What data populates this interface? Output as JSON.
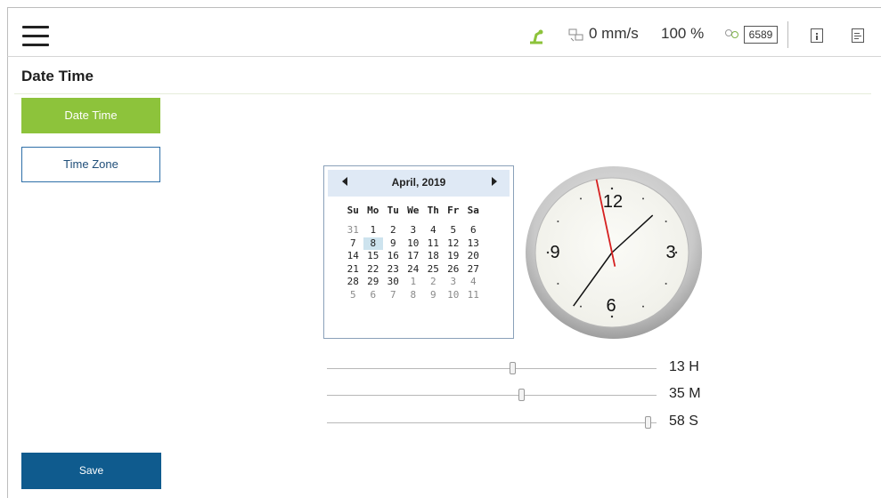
{
  "topbar": {
    "speed": "0 mm/s",
    "speed_percent": "100 %",
    "counter": "6589",
    "robot_icon_color": "#8dc33b"
  },
  "page": {
    "title": "Date Time"
  },
  "nav": {
    "items": [
      {
        "label": "Date Time",
        "active": true
      },
      {
        "label": "Time Zone",
        "active": false
      }
    ]
  },
  "calendar": {
    "month_label": "April, 2019",
    "days_of_week": [
      "Su",
      "Mo",
      "Tu",
      "We",
      "Th",
      "Fr",
      "Sa"
    ],
    "selected_day": "8",
    "weeks": [
      [
        "31",
        "1",
        "2",
        "3",
        "4",
        "5",
        "6"
      ],
      [
        "7",
        "8",
        "9",
        "10",
        "11",
        "12",
        "13"
      ],
      [
        "14",
        "15",
        "16",
        "17",
        "18",
        "19",
        "20"
      ],
      [
        "21",
        "22",
        "23",
        "24",
        "25",
        "26",
        "27"
      ],
      [
        "28",
        "29",
        "30",
        "1",
        "2",
        "3",
        "4"
      ],
      [
        "5",
        "6",
        "7",
        "8",
        "9",
        "10",
        "11"
      ]
    ]
  },
  "clock": {
    "numerals": [
      "12",
      "3",
      "6",
      "9"
    ],
    "hours": 13,
    "minutes": 35,
    "seconds": 58
  },
  "sliders": [
    {
      "label": "13 H",
      "value": 13,
      "max": 23
    },
    {
      "label": "35 M",
      "value": 35,
      "max": 59
    },
    {
      "label": "58 S",
      "value": 58,
      "max": 59
    }
  ],
  "actions": {
    "save_label": "Save"
  },
  "colors": {
    "accent_green": "#8dc33b",
    "save_blue": "#0f5b8e",
    "second_hand": "#d62020"
  }
}
